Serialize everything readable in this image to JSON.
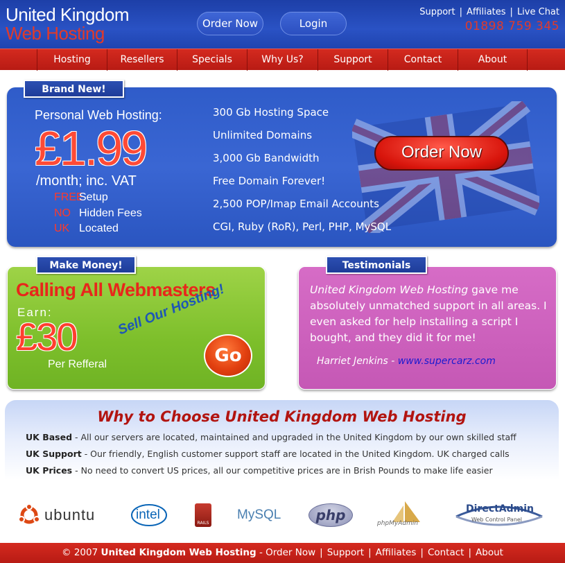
{
  "header": {
    "logo_line1": "United Kingdom",
    "logo_line2": "Web Hosting",
    "order_button": "Order Now",
    "login_button": "Login",
    "top_links": [
      "Support",
      "Affiliates",
      "Live Chat"
    ],
    "phone": "01898 759 345"
  },
  "nav": [
    "Hosting",
    "Resellers",
    "Specials",
    "Why Us?",
    "Support",
    "Contact",
    "About"
  ],
  "hero": {
    "tab": "Brand New!",
    "title": "Personal Web Hosting:",
    "price": "£1.99",
    "period": "/month; inc. VAT",
    "bullets": [
      {
        "accent": "FREE",
        "text": "Setup"
      },
      {
        "accent": "NO",
        "text": "Hidden Fees"
      },
      {
        "accent": "UK",
        "text": "Located"
      }
    ],
    "features": [
      "300 Gb Hosting Space",
      "Unlimited Domains",
      "3,000 Gb Bandwidth",
      "Free Domain Forever!",
      "2,500 POP/Imap Email Accounts",
      "CGI, Ruby (RoR), Perl, PHP, MySQL"
    ],
    "order_button": "Order Now"
  },
  "money": {
    "tab": "Make Money!",
    "title": "Calling All Webmasters",
    "earn": "Earn:",
    "amount": "£30",
    "per": "Per Refferal",
    "sell": "Sell Our Hosting!",
    "go": "Go"
  },
  "testimonials": {
    "tab": "Testimonials",
    "quote_name": "United Kingdom Web Hosting",
    "quote_rest": " gave me absolutely unmatched support in all areas. I even asked for help installing a script I bought, and they did it for me!",
    "author": "Harriet Jenkins",
    "author_sep": " - ",
    "site": "www.supercarz.com"
  },
  "why": {
    "title": "Why to Choose United Kingdom Web Hosting",
    "rows": [
      {
        "label": "UK Based",
        "text": " - All our servers are located, maintained and upgraded in the United Kingdom by our own skilled staff"
      },
      {
        "label": "UK Support",
        "text": " - Our friendly, English customer support staff are located in the United Kingdom. UK charged calls"
      },
      {
        "label": "UK Prices",
        "text": " - No need to convert US prices, all our competitive prices are in Brish Pounds to make life easier"
      }
    ]
  },
  "logos": {
    "ubuntu": "ubuntu",
    "intel": "intel",
    "rails": "RAILS",
    "mysql": "MySQL",
    "php": "php",
    "phpmyadmin": "phpMyAdmin",
    "directadmin": "DirectAdmin",
    "directadmin_sub": "Web Control Panel"
  },
  "footer": {
    "copyright": "© 2007",
    "site_name": "United Kingdom Web Hosting",
    "dash": "-",
    "links": [
      "Order Now",
      "Support",
      "Affiliates",
      "Contact",
      "About"
    ]
  },
  "colors": {
    "header_blue": "#2a52c4",
    "nav_red": "#c8221a",
    "hero_blue": "#3a66d3",
    "money_green": "#7dbf2b",
    "testimonial_pink": "#c558b5",
    "why_title_red": "#b21410"
  }
}
